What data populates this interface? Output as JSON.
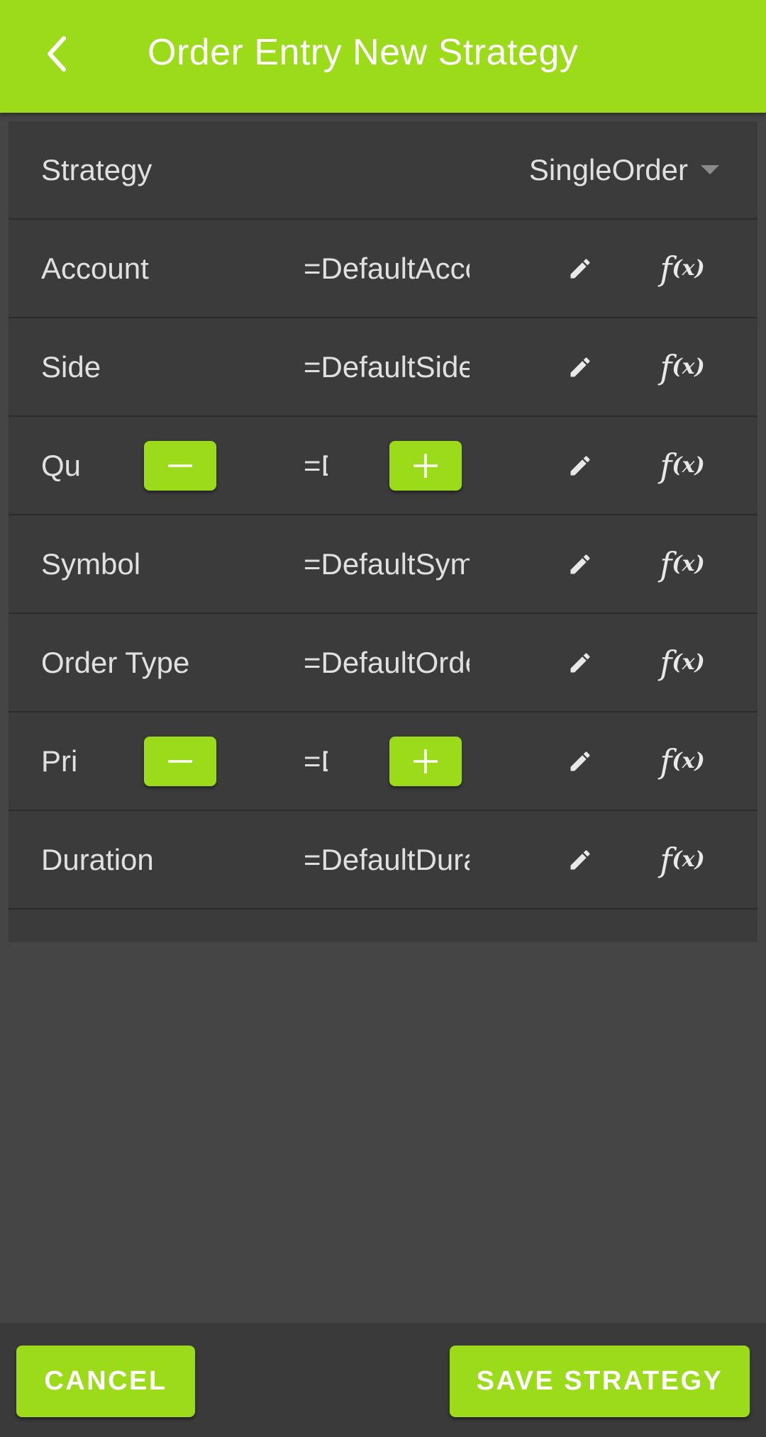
{
  "header": {
    "title": "Order Entry New Strategy",
    "back_icon": "chevron-left-icon",
    "accent_color": "#9bdb1a"
  },
  "strategy": {
    "label": "Strategy",
    "selected": "SingleOrder"
  },
  "fields": [
    {
      "label": "Account",
      "value": "=DefaultAccount",
      "stepper": false
    },
    {
      "label": "Side",
      "value": "=DefaultSide",
      "stepper": false
    },
    {
      "label": "Qu",
      "value": "=D",
      "stepper": true
    },
    {
      "label": "Symbol",
      "value": "=DefaultSymbol",
      "stepper": false
    },
    {
      "label": "Order Type",
      "value": "=DefaultOrderType",
      "stepper": false
    },
    {
      "label": "Pri",
      "value": "=D",
      "stepper": true
    },
    {
      "label": "Duration",
      "value": "=DefaultDuration",
      "stepper": false
    }
  ],
  "icons": {
    "edit": "pencil-icon",
    "formula_f": "f",
    "formula_x": "(x)",
    "minus": "minus-icon",
    "plus": "plus-icon"
  },
  "footer": {
    "cancel_label": "CANCEL",
    "save_label": "SAVE STRATEGY"
  }
}
